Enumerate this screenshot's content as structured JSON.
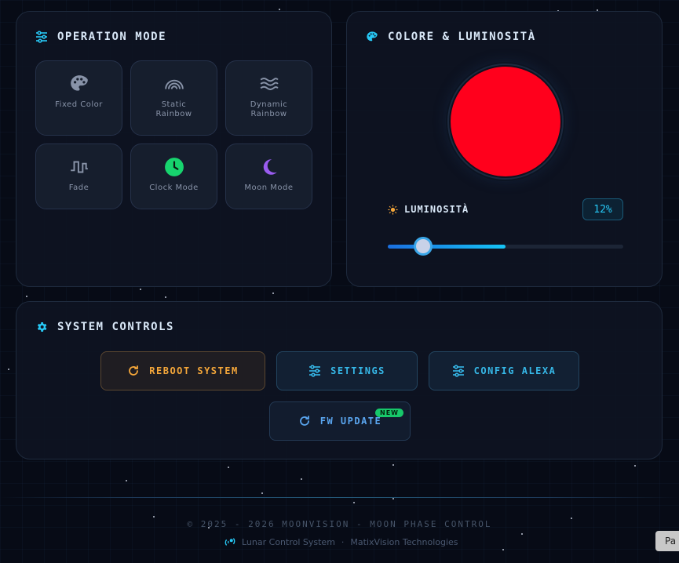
{
  "operation_mode": {
    "title": "OPERATION MODE",
    "modes": [
      {
        "label": "Fixed Color",
        "icon": "palette-icon",
        "color": "#8893a8"
      },
      {
        "label": "Static Rainbow",
        "icon": "rainbow-icon",
        "color": "#8893a8"
      },
      {
        "label": "Dynamic Rainbow",
        "icon": "waves-icon",
        "color": "#8893a8"
      },
      {
        "label": "Fade",
        "icon": "square-wave-icon",
        "color": "#8893a8"
      },
      {
        "label": "Clock Mode",
        "icon": "clock-icon",
        "color": "#17d46e"
      },
      {
        "label": "Moon Mode",
        "icon": "moon-icon",
        "color": "#9a5cf0"
      }
    ]
  },
  "color_panel": {
    "title": "COLORE & LUMINOSITÀ",
    "current_color": "#ff001c",
    "brightness_label": "LUMINOSITÀ",
    "brightness_value": "12%",
    "slider_fraction": 0.15,
    "slider_fill_fraction": 0.5
  },
  "system_controls": {
    "title": "SYSTEM CONTROLS",
    "reboot_label": "REBOOT SYSTEM",
    "settings_label": "SETTINGS",
    "alexa_label": "CONFIG ALEXA",
    "fw_label": "FW UPDATE",
    "fw_badge": "NEW"
  },
  "footer": {
    "copyright": "© 2025 - 2026 MOONVISION - MOON PHASE CONTROL",
    "system_name": "Lunar Control System",
    "separator": "·",
    "company": "MatixVision Technologies"
  },
  "side_tab": {
    "label": "Pa"
  },
  "colors": {
    "accent": "#27c8f5",
    "reboot": "#f5a73a",
    "clock_active": "#17d46e",
    "moon": "#9a5cf0",
    "new_badge": "#17c86a"
  }
}
